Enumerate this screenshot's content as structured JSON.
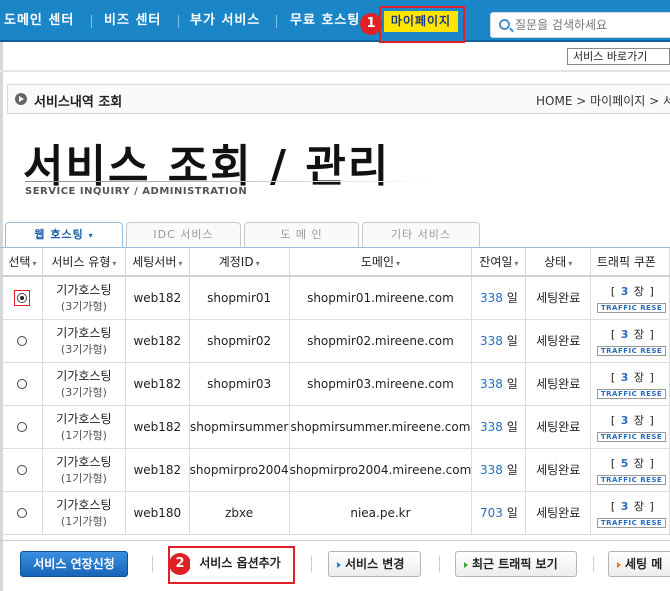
{
  "topnav": {
    "items": [
      "도메인 센터",
      "비즈 센터",
      "부가 서비스",
      "무료 호스팅"
    ],
    "mypage": "마이페이지",
    "search_placeholder": "질문을 검색하세요"
  },
  "annotations": {
    "badge1": "1",
    "badge2": "2"
  },
  "shortcut": "서비스 바로가기",
  "page": {
    "section_title": "서비스내역 조회",
    "breadcrumb": "HOME > 마이페이지 > 서",
    "big_title": "서비스 조회 / 관리",
    "subtitle": "SERVICE INQUIRY / ADMINISTRATION"
  },
  "tabs": [
    "웹 호스팅",
    "IDC 서비스",
    "도 메 인",
    "기타 서비스"
  ],
  "table": {
    "headers": [
      "선택",
      "서비스 유형",
      "세팅서버",
      "계정ID",
      "도메인",
      "잔여일",
      "상태",
      "트래픽 쿠폰"
    ],
    "rows": [
      {
        "type": "기가호스팅",
        "sub": "(3기가형)",
        "server": "web182",
        "id": "shopmir01",
        "domain": "shopmir01.mireene.com",
        "days": "338",
        "unit": "일",
        "status": "세팅완료",
        "coupon": "3",
        "selected": true
      },
      {
        "type": "기가호스팅",
        "sub": "(3기가형)",
        "server": "web182",
        "id": "shopmir02",
        "domain": "shopmir02.mireene.com",
        "days": "338",
        "unit": "일",
        "status": "세팅완료",
        "coupon": "3",
        "selected": false
      },
      {
        "type": "기가호스팅",
        "sub": "(3기가형)",
        "server": "web182",
        "id": "shopmir03",
        "domain": "shopmir03.mireene.com",
        "days": "338",
        "unit": "일",
        "status": "세팅완료",
        "coupon": "3",
        "selected": false
      },
      {
        "type": "기가호스팅",
        "sub": "(1기가형)",
        "server": "web182",
        "id": "shopmirsummer",
        "domain": "shopmirsummer.mireene.com",
        "days": "338",
        "unit": "일",
        "status": "세팅완료",
        "coupon": "3",
        "selected": false
      },
      {
        "type": "기가호스팅",
        "sub": "(1기가형)",
        "server": "web182",
        "id": "shopmirpro2004",
        "domain": "shopmirpro2004.mireene.com",
        "days": "338",
        "unit": "일",
        "status": "세팅완료",
        "coupon": "5",
        "selected": false
      },
      {
        "type": "기가호스팅",
        "sub": "(1기가형)",
        "server": "web180",
        "id": "zbxe",
        "domain": "niea.pe.kr",
        "days": "703",
        "unit": "일",
        "status": "세팅완료",
        "coupon": "3",
        "selected": false
      }
    ],
    "coupon_unit": "장",
    "traffic_label": "TRAFFIC",
    "reserve_label": "RESE"
  },
  "buttons": {
    "extend": "서비스 연장신청",
    "add_option": "서비스 옵션추가",
    "change": "서비스 변경",
    "traffic": "최근 트래픽 보기",
    "setting": "세팅 메"
  },
  "colors": {
    "nav": "#1a86c8",
    "highlight": "#e01f26",
    "mypage_bg": "#ffe400",
    "link": "#2a6cc0"
  }
}
